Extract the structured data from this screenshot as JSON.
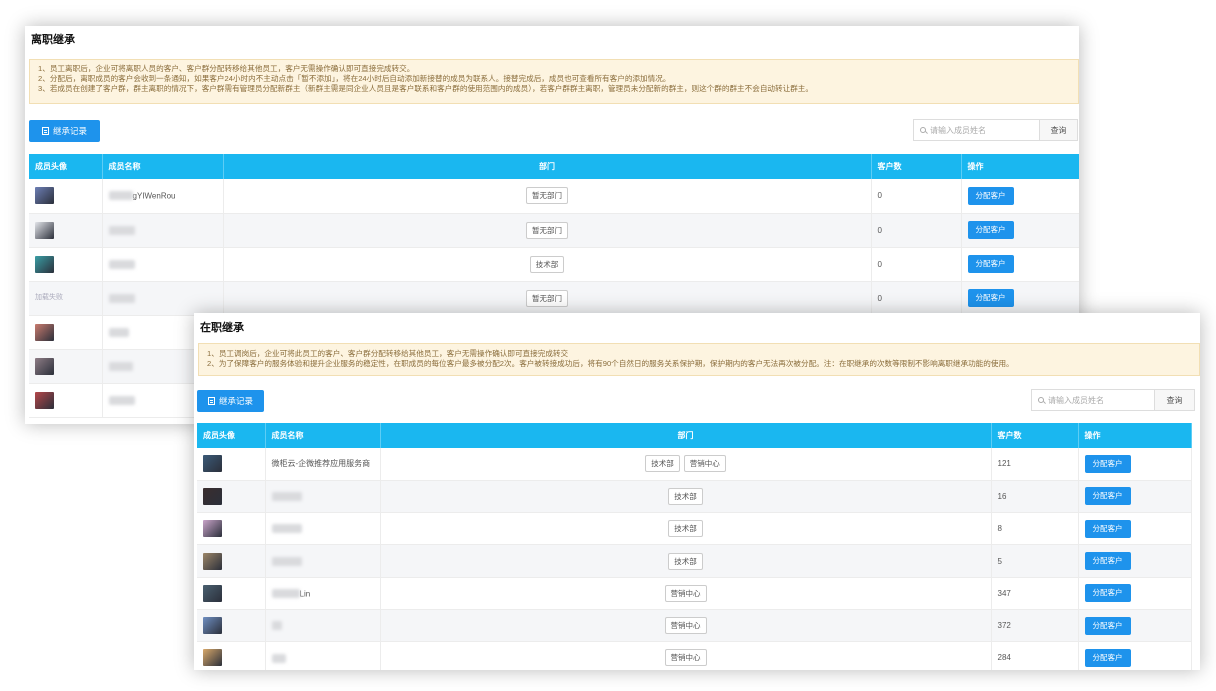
{
  "resigned": {
    "title": "离职继承",
    "notice": [
      "1、员工离职后，企业可将离职人员的客户、客户群分配转移给其他员工，客户无需操作确认即可直接完成转交。",
      "2、分配后，离职成员的客户会收到一条通知，如果客户24小时内不主动点击「暂不添加」，将在24小时后自动添加新接替的成员为联系人。接替完成后，成员也可查看所有客户的添加情况。",
      "3、若成员在创建了客户群，群主离职的情况下，客户群需有管理员分配新群主（新群主需是同企业人员且是客户联系和客户群的使用范围内的成员），若客户群群主离职，管理员未分配新的群主，则这个群的群主不会自动转让群主。"
    ],
    "history_button": "继承记录",
    "search_placeholder": "请输入成员姓名",
    "search_button": "查询",
    "columns": [
      "成员头像",
      "成员名称",
      "部门",
      "客户数",
      "操作"
    ],
    "rows": [
      {
        "name": "gYIWenRou",
        "departments": [
          "暂无部门"
        ],
        "customers": "0",
        "action": "分配客户",
        "avatar_color": "#6d7fb5"
      },
      {
        "name": "",
        "departments": [
          "暂无部门"
        ],
        "customers": "0",
        "action": "分配客户",
        "avatar_color": "#e3e5ea"
      },
      {
        "name": "",
        "departments": [
          "技术部"
        ],
        "customers": "0",
        "action": "分配客户",
        "avatar_color": "#3a9ea5"
      },
      {
        "name": "",
        "departments": [
          "暂无部门"
        ],
        "customers": "0",
        "action": "分配客户",
        "avatar_text": "加载失败"
      },
      {
        "name": "",
        "departments": [],
        "customers": "",
        "action": "",
        "avatar_color": "#c97b6e"
      },
      {
        "name": "",
        "departments": [],
        "customers": "",
        "action": "",
        "avatar_color": "#8e7d86"
      },
      {
        "name": "",
        "departments": [],
        "customers": "",
        "action": "",
        "avatar_color": "#b4474a"
      }
    ]
  },
  "active": {
    "title": "在职继承",
    "notice": [
      "1、员工调岗后，企业可将此员工的客户、客户群分配转移给其他员工，客户无需操作确认即可直接完成转交",
      "2、为了保障客户的服务体验和提升企业服务的稳定性，在职成员的每位客户最多被分配2次。客户被转接成功后，将有90个自然日的服务关系保护期，保护期内的客户无法再次被分配。注：在职继承的次数等限制不影响离职继承功能的使用。"
    ],
    "history_button": "继承记录",
    "search_placeholder": "请输入成员姓名",
    "search_button": "查询",
    "columns": [
      "成员头像",
      "成员名称",
      "部门",
      "客户数",
      "操作"
    ],
    "rows": [
      {
        "name": "微柜云-企微推荐应用服务商",
        "departments": [
          "技术部",
          "营销中心"
        ],
        "customers": "121",
        "action": "分配客户",
        "avatar_color": "#3b5a78"
      },
      {
        "name": "",
        "departments": [
          "技术部"
        ],
        "customers": "16",
        "action": "分配客户",
        "avatar_color": "#3a2e2e"
      },
      {
        "name": "",
        "departments": [
          "技术部"
        ],
        "customers": "8",
        "action": "分配客户",
        "avatar_color": "#c9a4c9"
      },
      {
        "name": "",
        "departments": [
          "技术部"
        ],
        "customers": "5",
        "action": "分配客户",
        "avatar_color": "#9c8668"
      },
      {
        "name": "Lin",
        "departments": [
          "营销中心"
        ],
        "customers": "347",
        "action": "分配客户",
        "avatar_color": "#4a6070"
      },
      {
        "name": "",
        "departments": [
          "营销中心"
        ],
        "customers": "372",
        "action": "分配客户",
        "avatar_color": "#6f8fc2"
      },
      {
        "name": "",
        "departments": [
          "营销中心"
        ],
        "customers": "284",
        "action": "分配客户",
        "avatar_color": "#d8a86a"
      }
    ]
  }
}
